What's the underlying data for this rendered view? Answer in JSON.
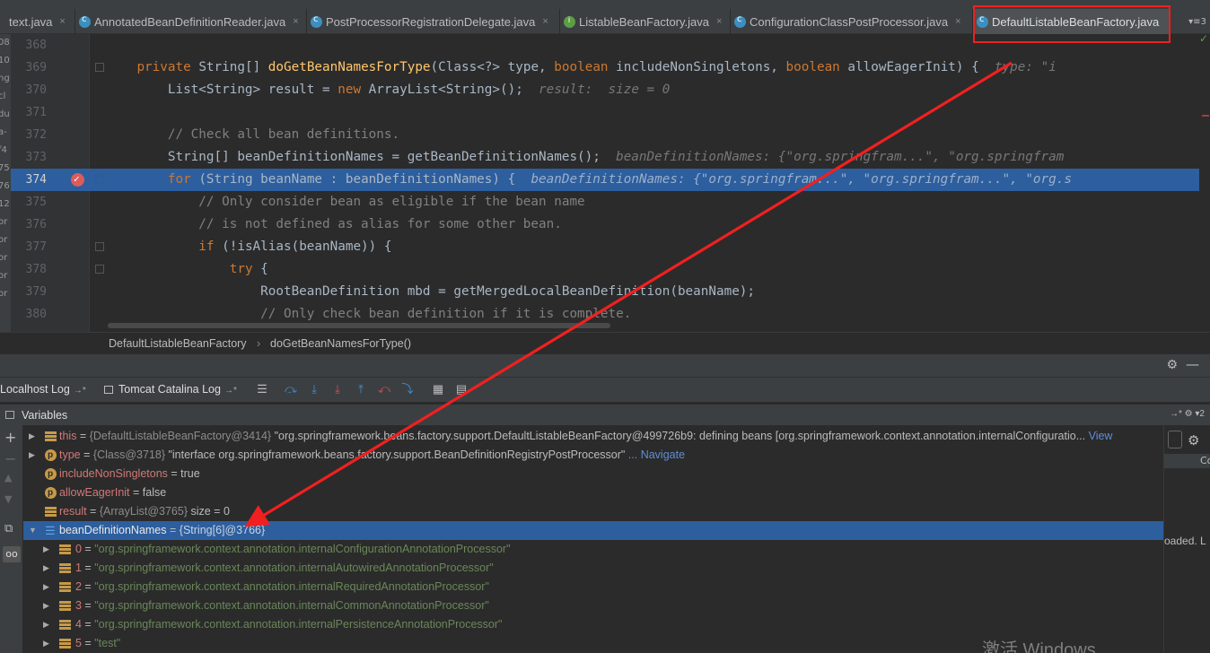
{
  "tabs": [
    {
      "label": "text.java",
      "icon": "none",
      "active": false
    },
    {
      "label": "AnnotatedBeanDefinitionReader.java",
      "icon": "class",
      "active": false
    },
    {
      "label": "PostProcessorRegistrationDelegate.java",
      "icon": "class",
      "active": false
    },
    {
      "label": "ListableBeanFactory.java",
      "icon": "interface",
      "active": false
    },
    {
      "label": "ConfigurationClassPostProcessor.java",
      "icon": "class",
      "active": false
    },
    {
      "label": "DefaultListableBeanFactory.java",
      "icon": "class",
      "active": true
    }
  ],
  "tab_close": "×",
  "tab_menu": "▾≡3",
  "left_fragments": [
    "08",
    "10",
    "ng",
    "cl",
    "du",
    "a-",
    "f4",
    "75",
    "76",
    "12",
    "or",
    "or",
    "or",
    "or",
    "or"
  ],
  "editor": {
    "lines": [
      {
        "num": "368",
        "tokens": []
      },
      {
        "num": "369",
        "tokens": [
          {
            "t": "    ",
            "c": "tx"
          },
          {
            "t": "private ",
            "c": "kw"
          },
          {
            "t": "String[] ",
            "c": "tx"
          },
          {
            "t": "doGetBeanNamesForType",
            "c": "fn"
          },
          {
            "t": "(Class<?> type, ",
            "c": "tx"
          },
          {
            "t": "boolean ",
            "c": "kw"
          },
          {
            "t": "includeNonSingletons, ",
            "c": "tx"
          },
          {
            "t": "boolean ",
            "c": "kw"
          },
          {
            "t": "allowEagerInit) {  ",
            "c": "tx"
          },
          {
            "t": "type: \"i",
            "c": "hint"
          }
        ]
      },
      {
        "num": "370",
        "tokens": [
          {
            "t": "        List<String> result = ",
            "c": "tx"
          },
          {
            "t": "new ",
            "c": "kw"
          },
          {
            "t": "ArrayList<String>();  ",
            "c": "tx"
          },
          {
            "t": "result:  size = 0",
            "c": "hint"
          }
        ]
      },
      {
        "num": "371",
        "tokens": []
      },
      {
        "num": "372",
        "tokens": [
          {
            "t": "        // Check all bean definitions.",
            "c": "cm"
          }
        ]
      },
      {
        "num": "373",
        "tokens": [
          {
            "t": "        String[] beanDefinitionNames = getBeanDefinitionNames();  ",
            "c": "tx"
          },
          {
            "t": "beanDefinitionNames: {\"org.springfram...\", \"org.springfram",
            "c": "hint"
          }
        ]
      },
      {
        "num": "374",
        "highlight": true,
        "breakpoint": true,
        "tokens": [
          {
            "t": "        ",
            "c": "tx"
          },
          {
            "t": "for ",
            "c": "kw"
          },
          {
            "t": "(String beanName : beanDefinitionNames) {  ",
            "c": "tx"
          },
          {
            "t": "beanDefinitionNames: {\"org.springfram...\", \"org.springfram...\", \"org.s",
            "c": "hint"
          }
        ]
      },
      {
        "num": "375",
        "tokens": [
          {
            "t": "            // Only consider bean as eligible if the bean name",
            "c": "cm"
          }
        ]
      },
      {
        "num": "376",
        "tokens": [
          {
            "t": "            // is not defined as alias for some other bean.",
            "c": "cm"
          }
        ]
      },
      {
        "num": "377",
        "tokens": [
          {
            "t": "            ",
            "c": "tx"
          },
          {
            "t": "if ",
            "c": "kw"
          },
          {
            "t": "(!isAlias(beanName)) {",
            "c": "tx"
          }
        ]
      },
      {
        "num": "378",
        "tokens": [
          {
            "t": "                ",
            "c": "tx"
          },
          {
            "t": "try ",
            "c": "kw"
          },
          {
            "t": "{",
            "c": "tx"
          }
        ]
      },
      {
        "num": "379",
        "tokens": [
          {
            "t": "                    RootBeanDefinition mbd = getMergedLocalBeanDefinition(beanName);",
            "c": "tx"
          }
        ]
      },
      {
        "num": "380",
        "tokens": [
          {
            "t": "                    // Only check bean definition if it is complete.",
            "c": "cm"
          }
        ]
      }
    ]
  },
  "breadcrumb": {
    "class": "DefaultListableBeanFactory",
    "separator": "›",
    "method": "doGetBeanNamesForType()"
  },
  "debug_toolbar": {
    "gear": "⚙",
    "minimize": "—"
  },
  "log_tabs": [
    {
      "label": "Localhost Log",
      "pin": "→*"
    },
    {
      "label": "Tomcat Catalina Log",
      "pin": "→*"
    }
  ],
  "variables_panel": {
    "title": "Variables",
    "header_right": "→*  ⚙  ▾2",
    "rows": [
      {
        "expand": "▶",
        "icon": "lines",
        "name": "this",
        "ref": "{DefaultListableBeanFactory@3414}",
        "value": "\"org.springframework.beans.factory.support.DefaultListableBeanFactory@499726b9: defining beans [org.springframework.context.annotation.internalConfiguratio...",
        "link": "View"
      },
      {
        "expand": "▶",
        "icon": "field",
        "name": "type",
        "ref": "{Class@3718}",
        "value": "\"interface org.springframework.beans.factory.support.BeanDefinitionRegistryPostProcessor\"",
        "link": "... Navigate"
      },
      {
        "expand": "",
        "icon": "field",
        "name": "includeNonSingletons",
        "ref": "",
        "value": "true",
        "link": ""
      },
      {
        "expand": "",
        "icon": "field",
        "name": "allowEagerInit",
        "ref": "",
        "value": "false",
        "link": ""
      },
      {
        "expand": "",
        "icon": "lines",
        "name": "result",
        "ref": "{ArrayList@3765}",
        "value": "size = 0",
        "link": ""
      },
      {
        "expand": "▼",
        "icon": "array",
        "name": "beanDefinitionNames",
        "ref": "{String[6]@3766}",
        "value": "",
        "link": "",
        "selected": true
      }
    ],
    "children": [
      {
        "index": "0",
        "value": "\"org.springframework.context.annotation.internalConfigurationAnnotationProcessor\""
      },
      {
        "index": "1",
        "value": "\"org.springframework.context.annotation.internalAutowiredAnnotationProcessor\""
      },
      {
        "index": "2",
        "value": "\"org.springframework.context.annotation.internalRequiredAnnotationProcessor\""
      },
      {
        "index": "3",
        "value": "\"org.springframework.context.annotation.internalCommonAnnotationProcessor\""
      },
      {
        "index": "4",
        "value": "\"org.springframework.context.annotation.internalPersistenceAnnotationProcessor\""
      },
      {
        "index": "5",
        "value": "\"test\""
      }
    ]
  },
  "right_panel": {
    "col": "Co",
    "loaded": "oaded. L"
  },
  "watermark": "激活 Windows",
  "annotation_color": "#f02020"
}
